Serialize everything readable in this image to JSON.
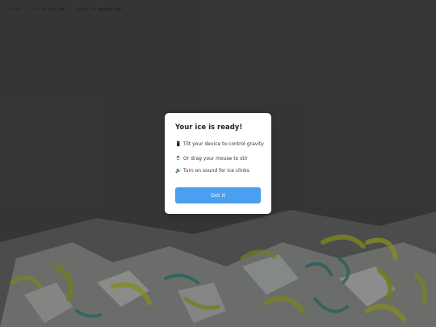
{
  "topbar": {
    "back_label": "← Back",
    "items": [
      {
        "label": "tilt: off",
        "value": "tilt: off"
      },
      {
        "label": "sound: off",
        "value": "sound: off"
      }
    ]
  },
  "modal": {
    "title": "Your ice is ready!",
    "tips": [
      {
        "icon": "phone-icon",
        "glyph": "📱",
        "text": "Tilt your device to control gravity"
      },
      {
        "icon": "mouse-icon",
        "glyph": "🖱",
        "text": "Or drag your mouse to stir"
      },
      {
        "icon": "speaker-icon",
        "glyph": "🔊",
        "text": "Turn on sound for ice clinks"
      }
    ],
    "button_label": "Got it"
  },
  "colors": {
    "background": "#3a3a3a",
    "button": "#4a9ff0",
    "ice": "#cfd6d2",
    "lime": "#9aa81c",
    "teal": "#1f7f7a"
  }
}
